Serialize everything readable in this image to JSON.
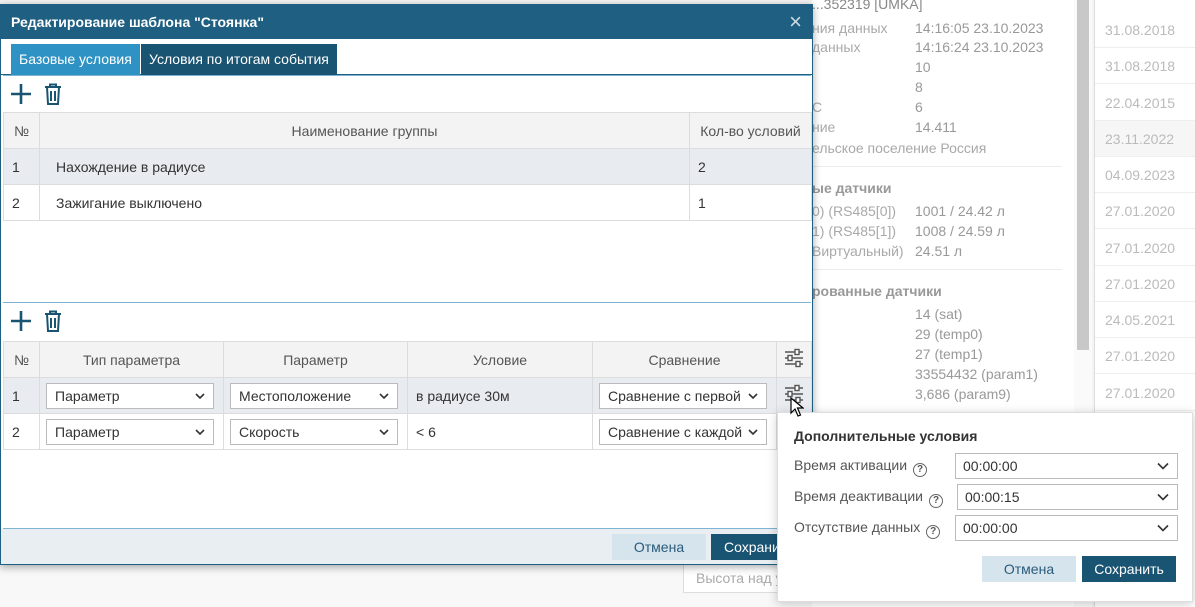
{
  "background": {
    "top_fragment": "...352319 [UMKA]",
    "details": [
      {
        "label": "ния данных",
        "value": "14:16:05 23.10.2023"
      },
      {
        "label": "данных",
        "value": "14:16:24 23.10.2023"
      },
      {
        "label": "",
        "value": "10"
      },
      {
        "label": "",
        "value": "8"
      },
      {
        "label": "С",
        "value": "6"
      },
      {
        "label": "ние",
        "value": "14.411"
      },
      {
        "label": "ельское поселение Россия",
        "value": ""
      }
    ],
    "section1": "ые датчики",
    "sensors": [
      {
        "label": "0) (RS485[0])",
        "value": "1001 / 24.42 л"
      },
      {
        "label": "1) (RS485[1])",
        "value": "1008 / 24.59 л"
      },
      {
        "label": "Виртуальный)",
        "value": "24.51 л"
      }
    ],
    "section2": "рованные датчики",
    "params": [
      "14 (sat)",
      "29 (temp0)",
      "27 (temp1)",
      "33554432 (param1)",
      "3,686 (param9)"
    ],
    "dates": [
      "31.08.2018",
      "31.08.2018",
      "22.04.2015",
      "23.11.2022",
      "04.09.2023",
      "27.01.2020",
      "27.01.2020",
      "27.01.2020",
      "24.05.2021",
      "27.01.2020",
      "27.01.2020"
    ],
    "bottom_input": "Высота над у"
  },
  "dialog": {
    "title": "Редактирование шаблона \"Стоянка\"",
    "close": "×",
    "tabs": [
      "Базовые условия",
      "Условия по итогам события"
    ],
    "groups": {
      "headers": [
        "№",
        "Наименование группы",
        "Кол-во условий"
      ],
      "rows": [
        {
          "n": "1",
          "name": "Нахождение в радиусе",
          "count": "2"
        },
        {
          "n": "2",
          "name": "Зажигание выключено",
          "count": "1"
        }
      ]
    },
    "conditions": {
      "headers": [
        "№",
        "Тип параметра",
        "Параметр",
        "Условие",
        "Сравнение"
      ],
      "rows": [
        {
          "n": "1",
          "type": "Параметр",
          "param": "Местоположение",
          "cond": "в радиусе 30м",
          "compare": "Сравнение с первой"
        },
        {
          "n": "2",
          "type": "Параметр",
          "param": "Скорость",
          "cond": "< 6",
          "compare": "Сравнение с каждой"
        }
      ]
    },
    "cancel": "Отмена",
    "save": "Сохранить"
  },
  "popover": {
    "title": "Дополнительные условия",
    "rows": [
      {
        "label": "Время активации",
        "value": "00:00:00"
      },
      {
        "label": "Время деактивации",
        "value": "00:00:15"
      },
      {
        "label": "Отсутствие данных",
        "value": "00:00:00"
      }
    ],
    "cancel": "Отмена",
    "save": "Сохранить"
  },
  "colors": {
    "header": "#1f5f82",
    "tab_active": "#2e93c4",
    "tab_inactive": "#1a5473",
    "save": "#1a5473"
  }
}
